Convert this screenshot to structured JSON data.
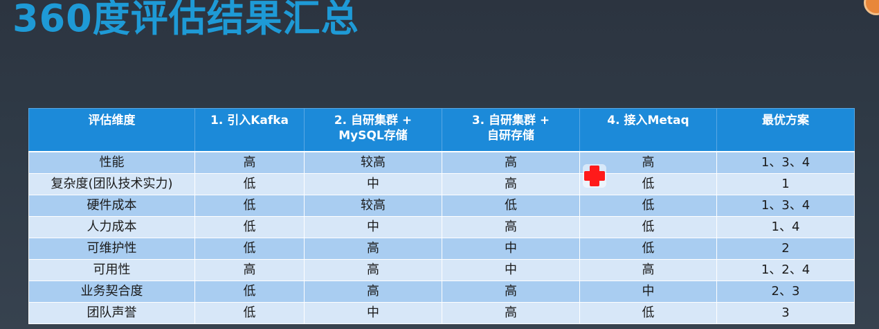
{
  "title": "360度评估结果汇总",
  "table": {
    "headers": [
      "评估维度",
      "1. 引入Kafka",
      "2. 自研集群 +\nMySQL存储",
      "3. 自研集群 +\n自研存储",
      "4. 接入Metaq",
      "最优方案"
    ],
    "rows": [
      [
        "性能",
        "高",
        "较高",
        "高",
        "高",
        "1、3、4"
      ],
      [
        "复杂度(团队技术实力)",
        "低",
        "中",
        "高",
        "低",
        "1"
      ],
      [
        "硬件成本",
        "低",
        "较高",
        "低",
        "低",
        "1、3、4"
      ],
      [
        "人力成本",
        "低",
        "中",
        "高",
        "低",
        "1、4"
      ],
      [
        "可维护性",
        "低",
        "高",
        "中",
        "低",
        "2"
      ],
      [
        "可用性",
        "高",
        "高",
        "中",
        "高",
        "1、2、4"
      ],
      [
        "业务契合度",
        "低",
        "高",
        "高",
        "中",
        "2、3"
      ],
      [
        "团队声誉",
        "低",
        "中",
        "高",
        "低",
        "3"
      ]
    ]
  },
  "colors": {
    "title": "#1e9ad6",
    "header_bg": "#1c8ad9",
    "row_dark": "#a9cdf1",
    "row_light": "#d7e7f8",
    "pointer": "#ff1a1a"
  },
  "icons": {
    "pointer": "red-cross-pointer-icon"
  }
}
